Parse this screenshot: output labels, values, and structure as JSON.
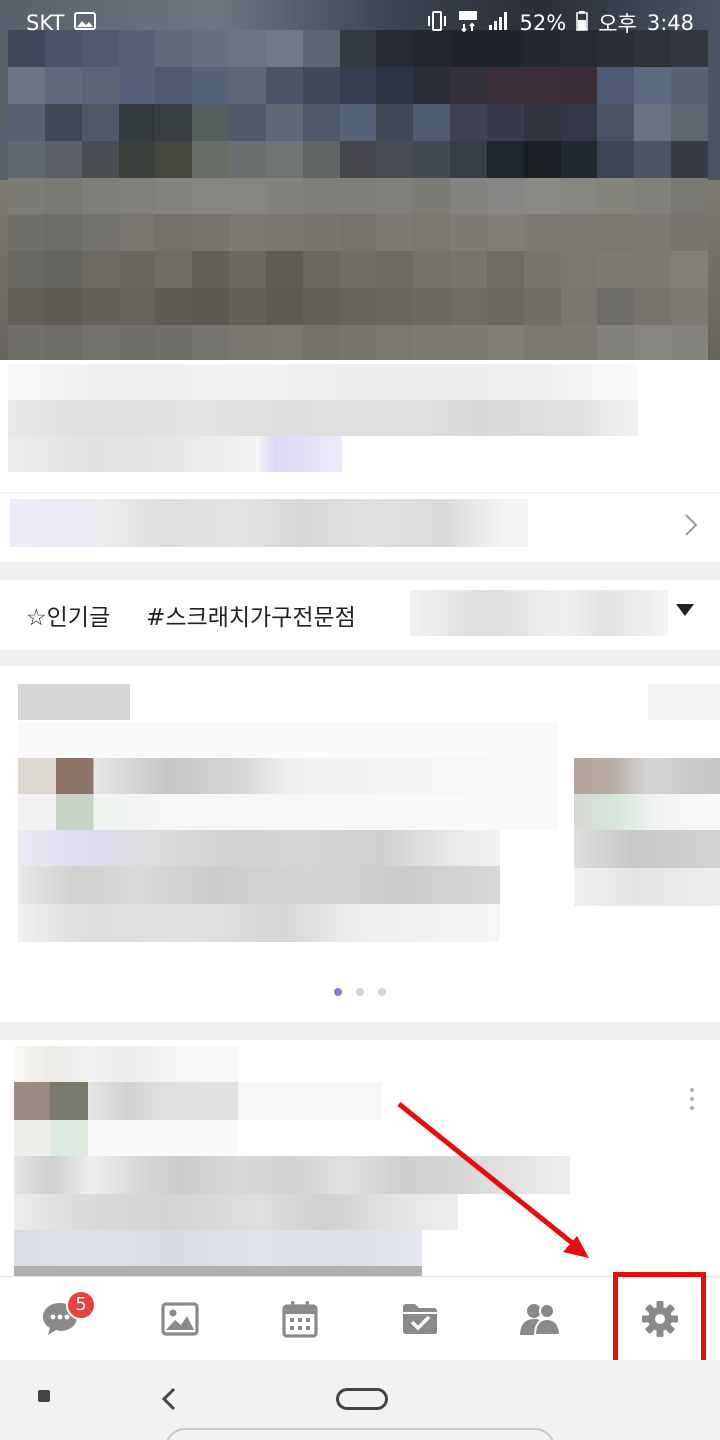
{
  "status_bar": {
    "carrier": "SKT",
    "battery": "52%",
    "period": "오후",
    "time": "3:48"
  },
  "tags_bar": {
    "popular_label": "☆인기글",
    "hashtag_label": "#스크래치가구전문점"
  },
  "bottom_nav": {
    "chat_badge": "5",
    "items": [
      "chat-icon",
      "photo-icon",
      "calendar-icon",
      "folder-check-icon",
      "members-icon",
      "settings-icon"
    ]
  },
  "colors": {
    "accent": "#8e7ad8",
    "badge": "#e8413e",
    "annotation": "#e80d0d",
    "icon": "#8a8a8a"
  }
}
